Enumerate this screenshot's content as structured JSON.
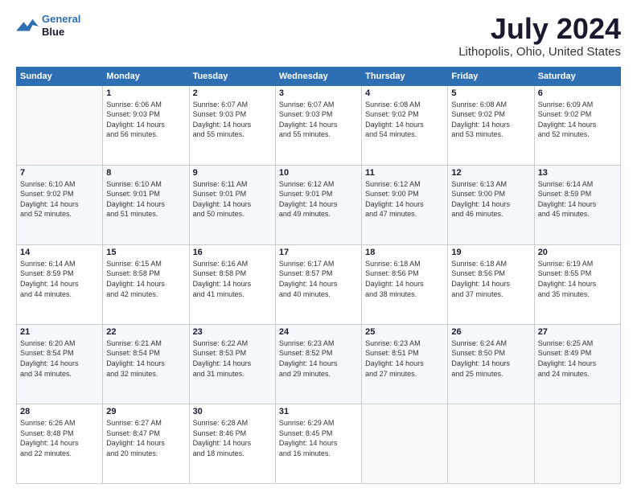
{
  "logo": {
    "line1": "General",
    "line2": "Blue"
  },
  "title": "July 2024",
  "subtitle": "Lithopolis, Ohio, United States",
  "days_of_week": [
    "Sunday",
    "Monday",
    "Tuesday",
    "Wednesday",
    "Thursday",
    "Friday",
    "Saturday"
  ],
  "weeks": [
    [
      {
        "day": "",
        "sunrise": "",
        "sunset": "",
        "daylight": ""
      },
      {
        "day": "1",
        "sunrise": "Sunrise: 6:06 AM",
        "sunset": "Sunset: 9:03 PM",
        "daylight": "Daylight: 14 hours and 56 minutes."
      },
      {
        "day": "2",
        "sunrise": "Sunrise: 6:07 AM",
        "sunset": "Sunset: 9:03 PM",
        "daylight": "Daylight: 14 hours and 55 minutes."
      },
      {
        "day": "3",
        "sunrise": "Sunrise: 6:07 AM",
        "sunset": "Sunset: 9:03 PM",
        "daylight": "Daylight: 14 hours and 55 minutes."
      },
      {
        "day": "4",
        "sunrise": "Sunrise: 6:08 AM",
        "sunset": "Sunset: 9:02 PM",
        "daylight": "Daylight: 14 hours and 54 minutes."
      },
      {
        "day": "5",
        "sunrise": "Sunrise: 6:08 AM",
        "sunset": "Sunset: 9:02 PM",
        "daylight": "Daylight: 14 hours and 53 minutes."
      },
      {
        "day": "6",
        "sunrise": "Sunrise: 6:09 AM",
        "sunset": "Sunset: 9:02 PM",
        "daylight": "Daylight: 14 hours and 52 minutes."
      }
    ],
    [
      {
        "day": "7",
        "sunrise": "Sunrise: 6:10 AM",
        "sunset": "Sunset: 9:02 PM",
        "daylight": "Daylight: 14 hours and 52 minutes."
      },
      {
        "day": "8",
        "sunrise": "Sunrise: 6:10 AM",
        "sunset": "Sunset: 9:01 PM",
        "daylight": "Daylight: 14 hours and 51 minutes."
      },
      {
        "day": "9",
        "sunrise": "Sunrise: 6:11 AM",
        "sunset": "Sunset: 9:01 PM",
        "daylight": "Daylight: 14 hours and 50 minutes."
      },
      {
        "day": "10",
        "sunrise": "Sunrise: 6:12 AM",
        "sunset": "Sunset: 9:01 PM",
        "daylight": "Daylight: 14 hours and 49 minutes."
      },
      {
        "day": "11",
        "sunrise": "Sunrise: 6:12 AM",
        "sunset": "Sunset: 9:00 PM",
        "daylight": "Daylight: 14 hours and 47 minutes."
      },
      {
        "day": "12",
        "sunrise": "Sunrise: 6:13 AM",
        "sunset": "Sunset: 9:00 PM",
        "daylight": "Daylight: 14 hours and 46 minutes."
      },
      {
        "day": "13",
        "sunrise": "Sunrise: 6:14 AM",
        "sunset": "Sunset: 8:59 PM",
        "daylight": "Daylight: 14 hours and 45 minutes."
      }
    ],
    [
      {
        "day": "14",
        "sunrise": "Sunrise: 6:14 AM",
        "sunset": "Sunset: 8:59 PM",
        "daylight": "Daylight: 14 hours and 44 minutes."
      },
      {
        "day": "15",
        "sunrise": "Sunrise: 6:15 AM",
        "sunset": "Sunset: 8:58 PM",
        "daylight": "Daylight: 14 hours and 42 minutes."
      },
      {
        "day": "16",
        "sunrise": "Sunrise: 6:16 AM",
        "sunset": "Sunset: 8:58 PM",
        "daylight": "Daylight: 14 hours and 41 minutes."
      },
      {
        "day": "17",
        "sunrise": "Sunrise: 6:17 AM",
        "sunset": "Sunset: 8:57 PM",
        "daylight": "Daylight: 14 hours and 40 minutes."
      },
      {
        "day": "18",
        "sunrise": "Sunrise: 6:18 AM",
        "sunset": "Sunset: 8:56 PM",
        "daylight": "Daylight: 14 hours and 38 minutes."
      },
      {
        "day": "19",
        "sunrise": "Sunrise: 6:18 AM",
        "sunset": "Sunset: 8:56 PM",
        "daylight": "Daylight: 14 hours and 37 minutes."
      },
      {
        "day": "20",
        "sunrise": "Sunrise: 6:19 AM",
        "sunset": "Sunset: 8:55 PM",
        "daylight": "Daylight: 14 hours and 35 minutes."
      }
    ],
    [
      {
        "day": "21",
        "sunrise": "Sunrise: 6:20 AM",
        "sunset": "Sunset: 8:54 PM",
        "daylight": "Daylight: 14 hours and 34 minutes."
      },
      {
        "day": "22",
        "sunrise": "Sunrise: 6:21 AM",
        "sunset": "Sunset: 8:54 PM",
        "daylight": "Daylight: 14 hours and 32 minutes."
      },
      {
        "day": "23",
        "sunrise": "Sunrise: 6:22 AM",
        "sunset": "Sunset: 8:53 PM",
        "daylight": "Daylight: 14 hours and 31 minutes."
      },
      {
        "day": "24",
        "sunrise": "Sunrise: 6:23 AM",
        "sunset": "Sunset: 8:52 PM",
        "daylight": "Daylight: 14 hours and 29 minutes."
      },
      {
        "day": "25",
        "sunrise": "Sunrise: 6:23 AM",
        "sunset": "Sunset: 8:51 PM",
        "daylight": "Daylight: 14 hours and 27 minutes."
      },
      {
        "day": "26",
        "sunrise": "Sunrise: 6:24 AM",
        "sunset": "Sunset: 8:50 PM",
        "daylight": "Daylight: 14 hours and 25 minutes."
      },
      {
        "day": "27",
        "sunrise": "Sunrise: 6:25 AM",
        "sunset": "Sunset: 8:49 PM",
        "daylight": "Daylight: 14 hours and 24 minutes."
      }
    ],
    [
      {
        "day": "28",
        "sunrise": "Sunrise: 6:26 AM",
        "sunset": "Sunset: 8:48 PM",
        "daylight": "Daylight: 14 hours and 22 minutes."
      },
      {
        "day": "29",
        "sunrise": "Sunrise: 6:27 AM",
        "sunset": "Sunset: 8:47 PM",
        "daylight": "Daylight: 14 hours and 20 minutes."
      },
      {
        "day": "30",
        "sunrise": "Sunrise: 6:28 AM",
        "sunset": "Sunset: 8:46 PM",
        "daylight": "Daylight: 14 hours and 18 minutes."
      },
      {
        "day": "31",
        "sunrise": "Sunrise: 6:29 AM",
        "sunset": "Sunset: 8:45 PM",
        "daylight": "Daylight: 14 hours and 16 minutes."
      },
      {
        "day": "",
        "sunrise": "",
        "sunset": "",
        "daylight": ""
      },
      {
        "day": "",
        "sunrise": "",
        "sunset": "",
        "daylight": ""
      },
      {
        "day": "",
        "sunrise": "",
        "sunset": "",
        "daylight": ""
      }
    ]
  ]
}
